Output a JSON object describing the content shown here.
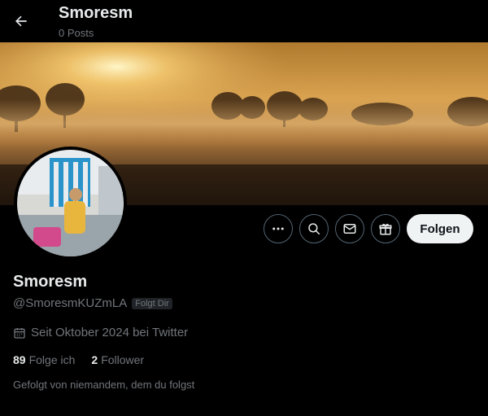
{
  "header": {
    "title": "Smoresm",
    "posts_count": "0 Posts",
    "back_icon": "arrow-left-icon"
  },
  "actions": {
    "more_icon": "more-horizontal-icon",
    "search_icon": "search-icon",
    "message_icon": "mail-icon",
    "gift_icon": "gift-icon",
    "follow_label": "Folgen"
  },
  "profile": {
    "display_name": "Smoresm",
    "handle": "@SmoresmKUZmLA",
    "follows_you_badge": "Folgt Dir",
    "joined": "Seit Oktober 2024 bei Twitter",
    "following_count": "89",
    "following_label": "Folge ich",
    "followers_count": "2",
    "followers_label": "Follower",
    "followed_by": "Gefolgt von niemandem, dem du folgst"
  },
  "colors": {
    "background": "#000000",
    "text_primary": "#e7e9ea",
    "text_secondary": "#71767b",
    "button_border": "#536471",
    "follow_button_bg": "#eff3f4"
  }
}
